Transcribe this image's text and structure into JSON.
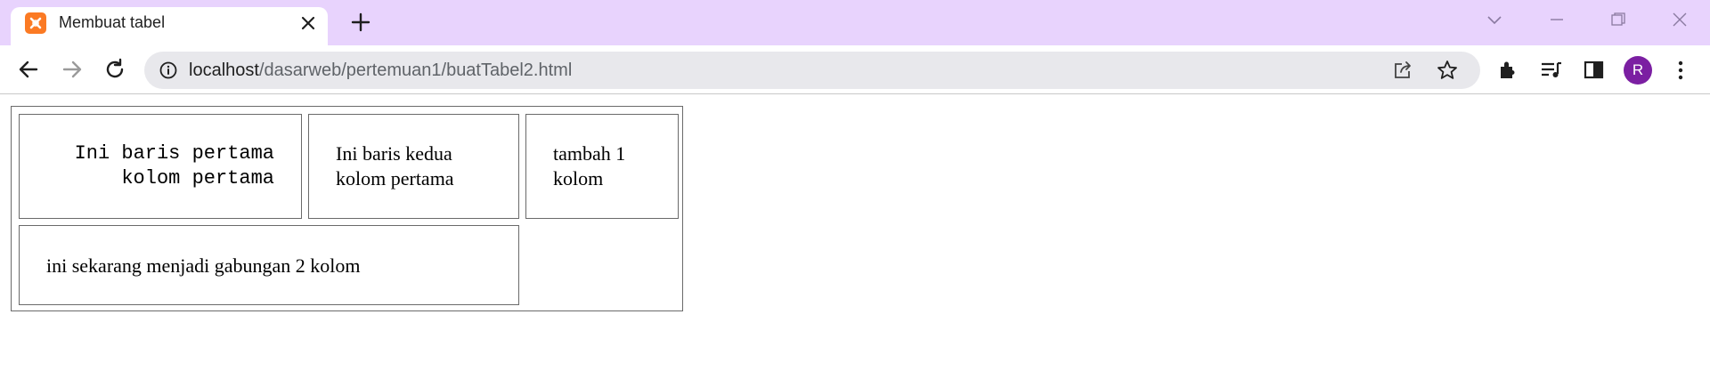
{
  "browser": {
    "tab": {
      "title": "Membuat tabel",
      "favicon": "xampp-icon"
    },
    "address_bar": {
      "url_host": "localhost",
      "url_path": "/dasarweb/pertemuan1/buatTabel2.html"
    },
    "profile_initial": "R",
    "colors": {
      "tabstrip": "#e8d3fd",
      "avatar": "#7b1fa2",
      "favicon": "#fb7a24"
    }
  },
  "table": {
    "row1": {
      "cell1": {
        "line1": "Ini baris pertama",
        "line2": "kolom pertama"
      },
      "cell2": {
        "line1": "Ini baris kedua",
        "line2": "kolom pertama"
      },
      "cell3": {
        "line1": "tambah 1",
        "line2": "kolom"
      }
    },
    "row2": {
      "cell1": {
        "text": "ini sekarang menjadi gabungan 2 kolom"
      }
    }
  }
}
